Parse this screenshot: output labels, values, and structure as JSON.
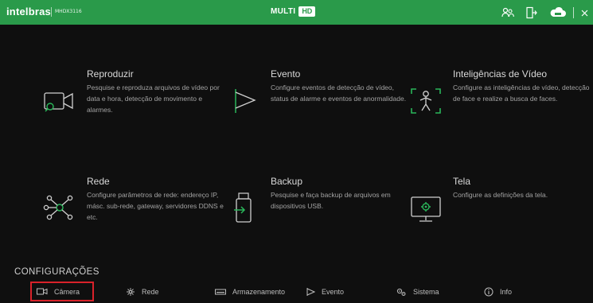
{
  "topbar": {
    "brand": "intelbras",
    "model": "MHDX3116",
    "center_logo": {
      "multi": "MULTI",
      "hd": "HD"
    },
    "icons": [
      "users-icon",
      "logout-icon",
      "cloud-icon",
      "close-icon"
    ],
    "bg_color": "#2a9a4a"
  },
  "tiles": [
    {
      "key": "reproduzir",
      "title": "Reproduzir",
      "desc": "Pesquise e reproduza arquivos de vídeo por data e hora, detecção de movimento e alarmes.",
      "icon": "camera-search-icon"
    },
    {
      "key": "evento",
      "title": "Evento",
      "desc": "Configure eventos de detecção de vídeo, status de alarme e eventos de anormalidade.",
      "icon": "flag-icon"
    },
    {
      "key": "inteligencias",
      "title": "Inteligências de Vídeo",
      "desc": "Configure as inteligências de vídeo, detecção de face e realize a busca de faces.",
      "icon": "person-detection-icon"
    },
    {
      "key": "rede",
      "title": "Rede",
      "desc": "Configure parâmetros de rede: endereço IP, másc. sub-rede, gateway, servidores DDNS e etc.",
      "icon": "network-icon"
    },
    {
      "key": "backup",
      "title": "Backup",
      "desc": "Pesquise e faça backup de arquivos em dispositivos USB.",
      "icon": "usb-backup-icon"
    },
    {
      "key": "tela",
      "title": "Tela",
      "desc": "Configure as definições da tela.",
      "icon": "monitor-settings-icon"
    }
  ],
  "config": {
    "title": "CONFIGURAÇÕES",
    "items": [
      {
        "label": "Câmera",
        "icon": "camera-icon",
        "selected": true
      },
      {
        "label": "Rede",
        "icon": "network-icon",
        "selected": false
      },
      {
        "label": "Armazenamento",
        "icon": "storage-icon",
        "selected": false
      },
      {
        "label": "Evento",
        "icon": "flag-icon",
        "selected": false
      },
      {
        "label": "Sistema",
        "icon": "gears-icon",
        "selected": false
      },
      {
        "label": "Info",
        "icon": "info-icon",
        "selected": false
      }
    ],
    "highlight_color": "#d9222a"
  }
}
